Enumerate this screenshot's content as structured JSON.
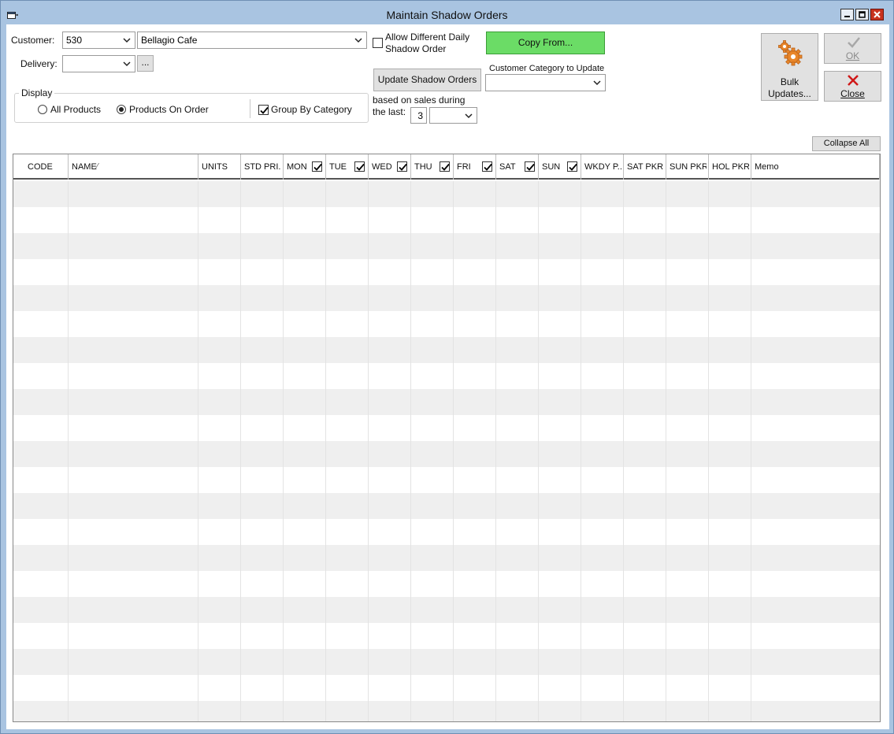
{
  "window": {
    "title": "Maintain Shadow Orders"
  },
  "customer": {
    "label": "Customer:",
    "code": "530",
    "name": "Bellagio Cafe"
  },
  "delivery": {
    "label": "Delivery:",
    "value": "",
    "browse_label": "..."
  },
  "allow_different": {
    "line1": "Allow Different Daily",
    "line2": "Shadow Order",
    "checked": false
  },
  "copy_from": {
    "label": "Copy From..."
  },
  "update_shadow": {
    "label": "Update Shadow Orders"
  },
  "customer_category": {
    "label": "Customer Category to Update",
    "value": ""
  },
  "based_on": {
    "line1": "based on sales during",
    "line2": "the last:",
    "count": "3",
    "period": ""
  },
  "display": {
    "legend": "Display",
    "all_products": "All Products",
    "products_on_order": "Products On Order",
    "selected": "products_on_order",
    "group_by_category": "Group By Category",
    "group_checked": true
  },
  "buttons": {
    "bulk_line1": "Bulk",
    "bulk_line2": "Updates...",
    "ok": "OK",
    "close": "Close",
    "collapse_all": "Collapse All"
  },
  "grid": {
    "columns": [
      {
        "key": "code",
        "label": "CODE"
      },
      {
        "key": "name",
        "label": "NAME"
      },
      {
        "key": "units",
        "label": "UNITS"
      },
      {
        "key": "std_price",
        "label": "STD PRI..."
      },
      {
        "key": "mon",
        "label": "MON",
        "checkbox": true
      },
      {
        "key": "tue",
        "label": "TUE",
        "checkbox": true
      },
      {
        "key": "wed",
        "label": "WED",
        "checkbox": true
      },
      {
        "key": "thu",
        "label": "THU",
        "checkbox": true
      },
      {
        "key": "fri",
        "label": "FRI",
        "checkbox": true
      },
      {
        "key": "sat",
        "label": "SAT",
        "checkbox": true
      },
      {
        "key": "sun",
        "label": "SUN",
        "checkbox": true
      },
      {
        "key": "wkdy_p",
        "label": "WKDY P..."
      },
      {
        "key": "sat_pkr",
        "label": "SAT PKR"
      },
      {
        "key": "sun_pkr",
        "label": "SUN PKR"
      },
      {
        "key": "hol_pkr",
        "label": "HOL PKR"
      },
      {
        "key": "memo",
        "label": "Memo"
      }
    ],
    "sort_indicator": "⁄",
    "rows": []
  },
  "colors": {
    "accent_green": "#6bdc66",
    "titlebar": "#a9c4e1",
    "close_red": "#c8321e"
  }
}
